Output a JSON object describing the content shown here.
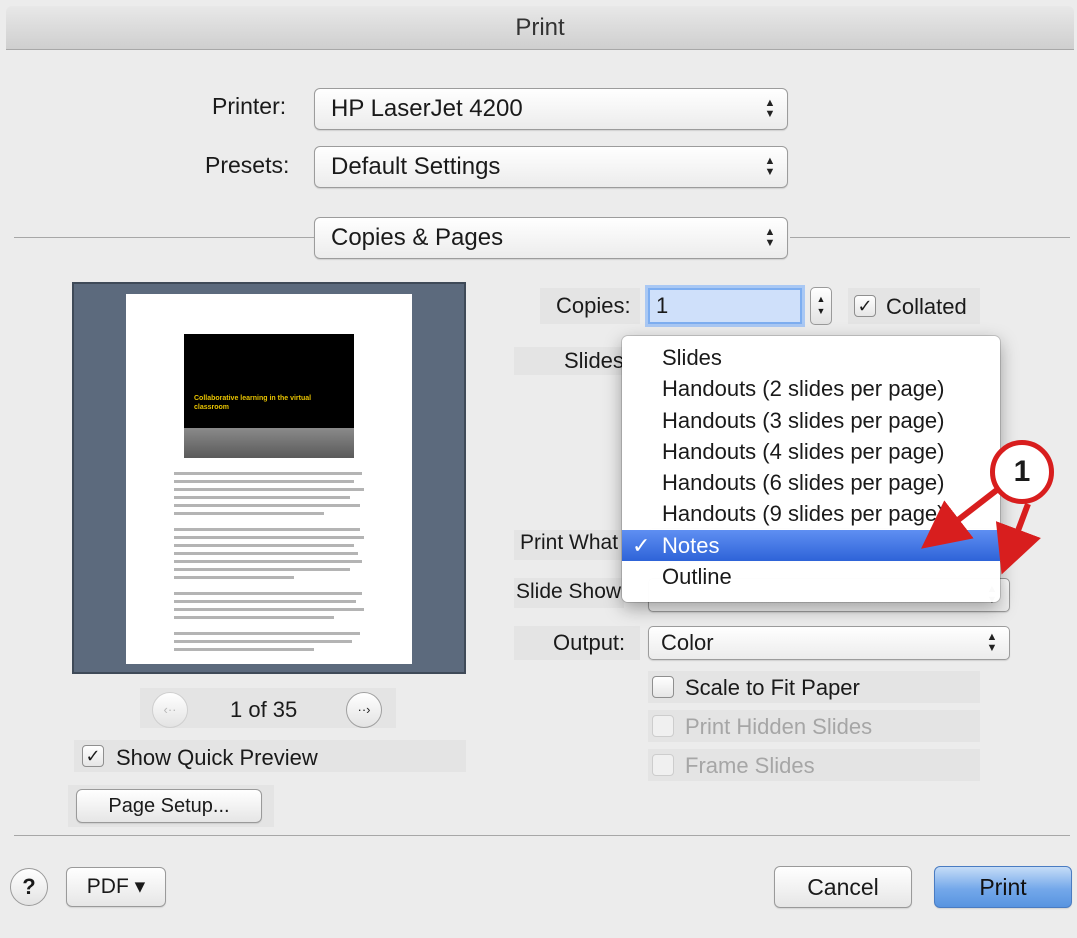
{
  "window": {
    "title": "Print"
  },
  "printer": {
    "label": "Printer:",
    "value": "HP LaserJet 4200"
  },
  "presets": {
    "label": "Presets:",
    "value": "Default Settings"
  },
  "section": {
    "value": "Copies & Pages"
  },
  "preview": {
    "slide_title": "Collaborative learning in the virtual classroom",
    "page_indicator": "1 of 35",
    "prev_icon": "prev-page-icon",
    "next_icon": "next-page-icon",
    "show_quick_preview": {
      "label": "Show Quick Preview",
      "checked": true
    }
  },
  "copies": {
    "label": "Copies:",
    "value": "1",
    "collated": {
      "label": "Collated",
      "checked": true
    }
  },
  "slides": {
    "label": "Slides"
  },
  "print_what": {
    "label": "Print What",
    "options": [
      "Slides",
      "Handouts (2 slides per page)",
      "Handouts (3 slides per page)",
      "Handouts (4 slides per page)",
      "Handouts (6 slides per page)",
      "Handouts (9 slides per page)",
      "Notes",
      "Outline"
    ],
    "selected": "Notes",
    "check_mark": "✓"
  },
  "slide_show": {
    "label": "Slide Show"
  },
  "output": {
    "label": "Output:",
    "value": "Color"
  },
  "options": {
    "scale_to_fit": {
      "label": "Scale to Fit Paper",
      "checked": false,
      "enabled": true
    },
    "print_hidden": {
      "label": "Print Hidden Slides",
      "checked": false,
      "enabled": false
    },
    "frame_slides": {
      "label": "Frame Slides",
      "checked": false,
      "enabled": false
    }
  },
  "buttons": {
    "page_setup": "Page Setup...",
    "help": "?",
    "pdf": "PDF ▾",
    "cancel": "Cancel",
    "print": "Print"
  },
  "annotation": {
    "number": "1",
    "color": "#d81e1e"
  }
}
